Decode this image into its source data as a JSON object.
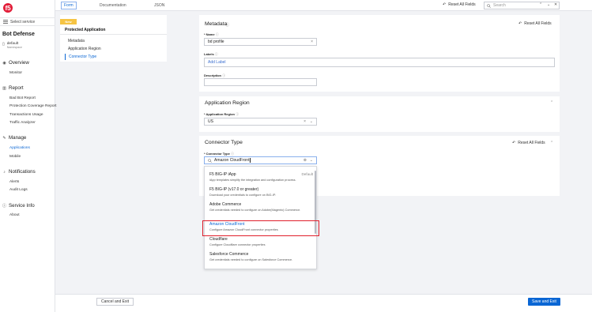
{
  "app": {
    "logo_text": "f5",
    "select_service": "Select service",
    "section_title": "Bot Defense",
    "namespace_label": "default",
    "namespace_sub": "Namespace"
  },
  "sidebar": {
    "overview": {
      "title": "Overview",
      "items": [
        "Monitor"
      ]
    },
    "report": {
      "title": "Report",
      "items": [
        "Bad Bot Report",
        "Protection Coverage Report",
        "Transactions Usage",
        "Traffic Analyzer"
      ]
    },
    "manage": {
      "title": "Manage",
      "items": [
        "Applications",
        "Mobile"
      ]
    },
    "notifications": {
      "title": "Notifications",
      "items": [
        "Alerts",
        "Audit Logs"
      ]
    },
    "service_info": {
      "title": "Service Info",
      "items": [
        "About"
      ]
    }
  },
  "topbar": {
    "tabs": [
      "Form",
      "Documentation",
      "JSON"
    ],
    "reset_all": "Reset All Fields",
    "search_placeholder": "Search"
  },
  "nav_card": {
    "badge": "New",
    "title": "Protected Application",
    "links": [
      "Metadata",
      "Application Region",
      "Connector Type"
    ]
  },
  "metadata": {
    "title": "Metadata",
    "reset": "Reset All Fields",
    "name_label": "Name",
    "name_value": "bd profile",
    "labels_label": "Labels",
    "labels_placeholder": "Add Label",
    "description_label": "Description",
    "description_value": ""
  },
  "region": {
    "title": "Application Region",
    "field_label": "Application Region",
    "value": "US"
  },
  "connector": {
    "title": "Connector Type",
    "reset": "Reset All Fields",
    "field_label": "Connector Type",
    "value": "Amazon CloudFront",
    "options": [
      {
        "title": "F5 BIG-IP iApp",
        "desc": "iApp templates simplify the integration and configuration process.",
        "tag": "Default"
      },
      {
        "title": "F5 BIG-IP (v17.0 or greater)",
        "desc": "Download your credentials to configure on BIG-IP.",
        "tag": ""
      },
      {
        "title": "Adobe Commerce",
        "desc": "Get credentials needed to configure on Adobe(Magento) Commerce.",
        "tag": ""
      },
      {
        "title": "Amazon CloudFront",
        "desc": "Configure Amazon CloudFront connector properties",
        "tag": ""
      },
      {
        "title": "Cloudflare",
        "desc": "Configure Cloudflare connector properties",
        "tag": ""
      },
      {
        "title": "Salesforce Commerce",
        "desc": "Get credentials needed to configure on Salesforce Commerce.",
        "tag": ""
      }
    ]
  },
  "footer": {
    "cancel": "Cancel and Exit",
    "save": "Save and Exit"
  },
  "colors": {
    "accent": "#0a66d4",
    "brand": "#e21d38",
    "highlight": "#e0202c",
    "badge": "#f6c443"
  }
}
